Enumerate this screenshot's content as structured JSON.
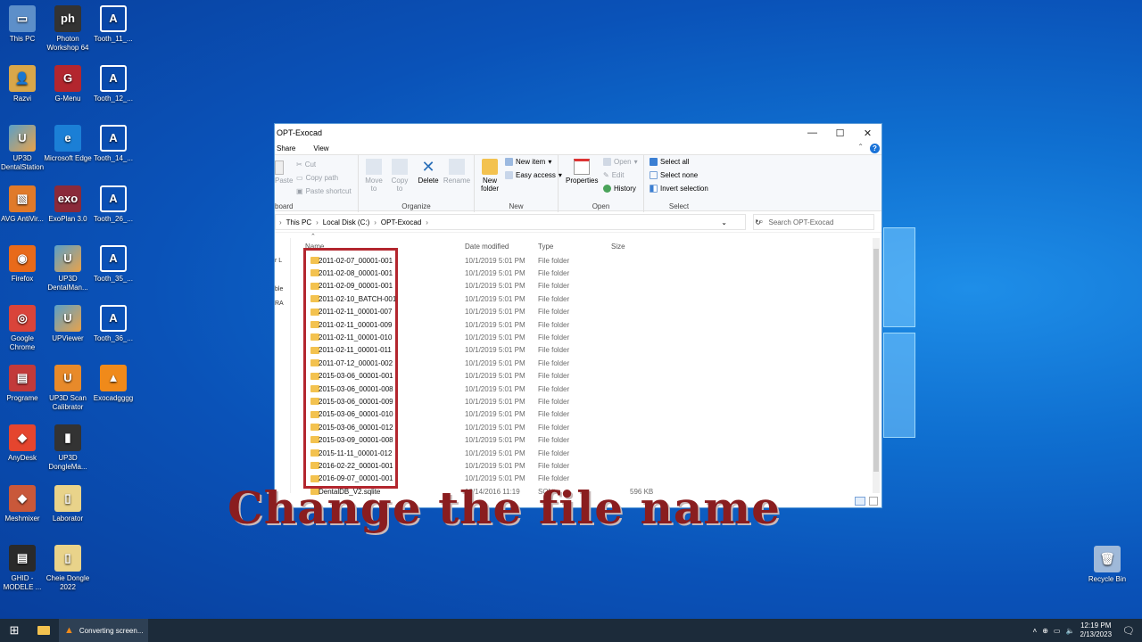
{
  "desktop_icons": [
    {
      "label": "This PC",
      "glyph": "▭",
      "color": "#5d8fc9"
    },
    {
      "label": "Photon Workshop 64",
      "glyph": "ph",
      "color": "#333"
    },
    {
      "label": "Tooth_11_...",
      "glyph": "A",
      "color": "tooth"
    },
    {
      "label": "Razvi",
      "glyph": "👤",
      "color": "#d9a74a"
    },
    {
      "label": "G-Menu",
      "glyph": "G",
      "color": "#b3262e"
    },
    {
      "label": "Tooth_12_...",
      "glyph": "A",
      "color": "tooth"
    },
    {
      "label": "UP3D DentalStation",
      "glyph": "U",
      "color": "up3d"
    },
    {
      "label": "Microsoft Edge",
      "glyph": "e",
      "color": "#1b7fd6"
    },
    {
      "label": "Tooth_14_...",
      "glyph": "A",
      "color": "tooth"
    },
    {
      "label": "AVG AntiVir...",
      "glyph": "▧",
      "color": "#e07a2a"
    },
    {
      "label": "ExoPlan 3.0",
      "glyph": "exo",
      "color": "#8a2a3a"
    },
    {
      "label": "Tooth_26_...",
      "glyph": "A",
      "color": "tooth"
    },
    {
      "label": "Firefox",
      "glyph": "◉",
      "color": "#e86a1a"
    },
    {
      "label": "UP3D DentalMan...",
      "glyph": "U",
      "color": "up3d"
    },
    {
      "label": "Tooth_35_...",
      "glyph": "A",
      "color": "tooth"
    },
    {
      "label": "Google Chrome",
      "glyph": "◎",
      "color": "#d9443a"
    },
    {
      "label": "UPViewer",
      "glyph": "U",
      "color": "up3d"
    },
    {
      "label": "Tooth_36_...",
      "glyph": "A",
      "color": "tooth"
    },
    {
      "label": "Programe",
      "glyph": "▤",
      "color": "#c23a3a"
    },
    {
      "label": "UP3D Scan Calibrator",
      "glyph": "U",
      "color": "#e88a2a"
    },
    {
      "label": "Exocadgggg",
      "glyph": "▲",
      "color": "#f08a1a"
    },
    {
      "label": "AnyDesk",
      "glyph": "◆",
      "color": "#e5452e"
    },
    {
      "label": "UP3D DongleMa...",
      "glyph": "▮",
      "color": "#333"
    },
    {
      "label": "Meshmixer",
      "glyph": "◆",
      "color": "#c9583a"
    },
    {
      "label": "Laborator",
      "glyph": "▯",
      "color": "#e9d38a"
    },
    {
      "label": "GHID - MODELE ...",
      "glyph": "▤",
      "color": "#2a2a2a"
    },
    {
      "label": "Cheie Dongle 2022",
      "glyph": "▯",
      "color": "#e9d38a"
    },
    {
      "label": "Recycle Bin",
      "glyph": "🗑",
      "color": "#9fb9d9"
    }
  ],
  "window": {
    "title": "OPT-Exocad",
    "tabs": [
      "Share",
      "View"
    ],
    "ribbon": {
      "clipboard": {
        "label": "board",
        "paste": "Paste",
        "cut": "Cut",
        "copy_path": "Copy path",
        "paste_shortcut": "Paste shortcut"
      },
      "organize": {
        "label": "Organize",
        "move_to": "Move to",
        "copy_to": "Copy to",
        "delete": "Delete",
        "rename": "Rename"
      },
      "new": {
        "label": "New",
        "new_folder": "New folder",
        "new_item": "New item",
        "easy_access": "Easy access"
      },
      "open": {
        "label": "Open",
        "properties": "Properties",
        "open": "Open",
        "edit": "Edit",
        "history": "History"
      },
      "select": {
        "label": "Select",
        "select_all": "Select all",
        "select_none": "Select none",
        "invert": "Invert selection"
      }
    },
    "path": [
      "This PC",
      "Local Disk (C:)",
      "OPT-Exocad"
    ],
    "search_placeholder": "Search OPT-Exocad",
    "nav_fragments": [
      "r L",
      "ble",
      "RA"
    ],
    "columns": {
      "name": "Name",
      "date": "Date modified",
      "type": "Type",
      "size": "Size"
    },
    "rows": [
      {
        "name": "2011-02-07_00001-001",
        "date": "10/1/2019 5:01 PM",
        "type": "File folder",
        "size": ""
      },
      {
        "name": "2011-02-08_00001-001",
        "date": "10/1/2019 5:01 PM",
        "type": "File folder",
        "size": ""
      },
      {
        "name": "2011-02-09_00001-001",
        "date": "10/1/2019 5:01 PM",
        "type": "File folder",
        "size": ""
      },
      {
        "name": "2011-02-10_BATCH-001",
        "date": "10/1/2019 5:01 PM",
        "type": "File folder",
        "size": ""
      },
      {
        "name": "2011-02-11_00001-007",
        "date": "10/1/2019 5:01 PM",
        "type": "File folder",
        "size": ""
      },
      {
        "name": "2011-02-11_00001-009",
        "date": "10/1/2019 5:01 PM",
        "type": "File folder",
        "size": ""
      },
      {
        "name": "2011-02-11_00001-010",
        "date": "10/1/2019 5:01 PM",
        "type": "File folder",
        "size": ""
      },
      {
        "name": "2011-02-11_00001-011",
        "date": "10/1/2019 5:01 PM",
        "type": "File folder",
        "size": ""
      },
      {
        "name": "2011-07-12_00001-002",
        "date": "10/1/2019 5:01 PM",
        "type": "File folder",
        "size": ""
      },
      {
        "name": "2015-03-06_00001-001",
        "date": "10/1/2019 5:01 PM",
        "type": "File folder",
        "size": ""
      },
      {
        "name": "2015-03-06_00001-008",
        "date": "10/1/2019 5:01 PM",
        "type": "File folder",
        "size": ""
      },
      {
        "name": "2015-03-06_00001-009",
        "date": "10/1/2019 5:01 PM",
        "type": "File folder",
        "size": ""
      },
      {
        "name": "2015-03-06_00001-010",
        "date": "10/1/2019 5:01 PM",
        "type": "File folder",
        "size": ""
      },
      {
        "name": "2015-03-06_00001-012",
        "date": "10/1/2019 5:01 PM",
        "type": "File folder",
        "size": ""
      },
      {
        "name": "2015-03-09_00001-008",
        "date": "10/1/2019 5:01 PM",
        "type": "File folder",
        "size": ""
      },
      {
        "name": "2015-11-11_00001-012",
        "date": "10/1/2019 5:01 PM",
        "type": "File folder",
        "size": ""
      },
      {
        "name": "2016-02-22_00001-001",
        "date": "10/1/2019 5:01 PM",
        "type": "File folder",
        "size": ""
      },
      {
        "name": "2016-09-07_00001-001",
        "date": "10/1/2019 5:01 PM",
        "type": "File folder",
        "size": ""
      },
      {
        "name": "DentalDB_V2.sqlite",
        "date": "10/14/2016 11:19",
        "type": "SQLite",
        "size": "596 KB"
      }
    ]
  },
  "caption": "Change the file name",
  "taskbar": {
    "running_app": "Converting screen...",
    "time": "12:19 PM",
    "date": "2/13/2023"
  },
  "colors": {
    "highlight_box": "#b3262e",
    "caption": "#8a1d1f",
    "taskbar": "#1c2b3a"
  }
}
